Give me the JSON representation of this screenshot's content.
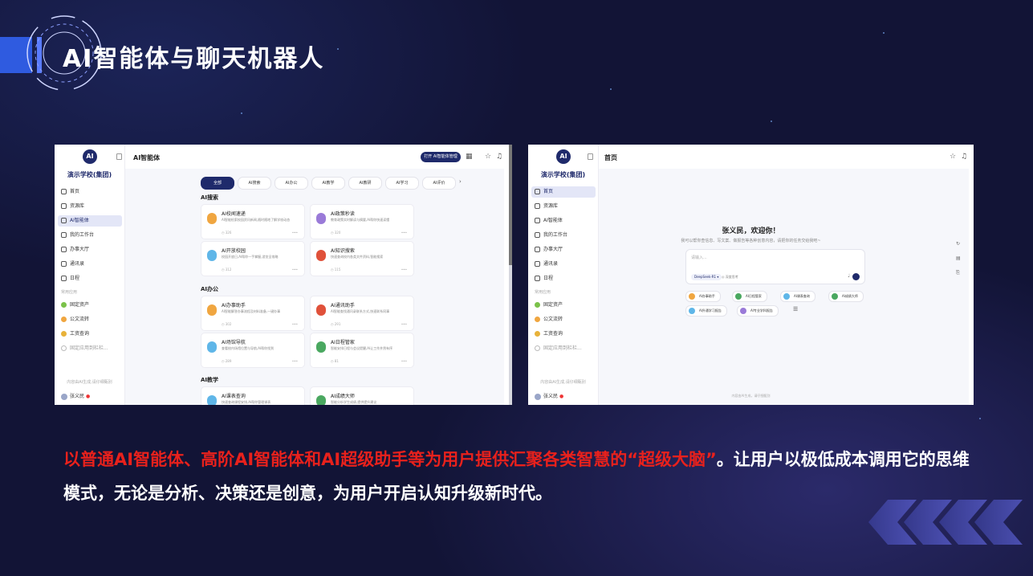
{
  "slide": {
    "title": "AI智能体与聊天机器人",
    "body_highlight": "以普通AI智能体、高阶AI智能体和AI超级助手等为用户提供汇聚各类智慧的“超级大脑”",
    "body_rest": "。让用户以极低成本调用它的思维模式，无论是分析、决策还是创意，为用户开启认知升级新时代。"
  },
  "left_window": {
    "school_name": "演示学校(集团)",
    "header_title": "AI智能体",
    "open_button": "打开 AI智能体管理",
    "nav": [
      "首页",
      "资源库",
      "AI智能体",
      "我的工作台",
      "办事大厅",
      "通讯录",
      "日程"
    ],
    "nav_section": "常用应用",
    "apps": [
      "固定资产",
      "公文流转",
      "工资查询",
      "固定应用到栏栏..."
    ],
    "side_footer": "内容由AI生成,请仔细甄别",
    "user": "张义民",
    "chips": [
      "全部",
      "AI搜索",
      "AI办公",
      "AI教学",
      "AI教研",
      "AI学习",
      "AI评价"
    ],
    "sections": [
      "AI搜索",
      "AI办公",
      "AI教学"
    ],
    "cards": [
      {
        "title": "AI校闻速递",
        "desc": "AI智能检索校园资讯新闻,随时随地了解学校动态",
        "meta": "◷ 326",
        "color": "#f0a640"
      },
      {
        "title": "AI政策秒读",
        "desc": "教育政策实时解读与摘要,AI帮你快速读懂",
        "meta": "◷ 320",
        "color": "#9a7ad8"
      },
      {
        "title": "AI开放校园",
        "desc": "校园开放日,AI帮你一手掌握,游览全攻略",
        "meta": "◷ 312",
        "color": "#5fb6e8"
      },
      {
        "title": "AI知识搜索",
        "desc": "快速查询校内各类文件资料,智能搜索",
        "meta": "◷ 115",
        "color": "#e0513a"
      },
      {
        "title": "AI办事助手",
        "desc": "AI智能解答办事流程及材料准备,一键办事",
        "meta": "◷ 302",
        "color": "#f0a640"
      },
      {
        "title": "AI通讯助手",
        "desc": "AI智能查找通讯录联系方式,快速联系同事",
        "meta": "◷ 291",
        "color": "#e0513a"
      },
      {
        "title": "AI场馆导航",
        "desc": "查看校内场馆位置与导航,AI帮你找到",
        "meta": "◷ 289",
        "color": "#5fb6e8"
      },
      {
        "title": "AI日程管家",
        "desc": "智能安排日程与会议提醒,AI让工作井然有序",
        "meta": "◷ 81",
        "color": "#4aa860"
      },
      {
        "title": "AI课表查询",
        "desc": "快速查询课程安排,AI帮你管理课表",
        "meta": "",
        "color": "#5fb6e8"
      },
      {
        "title": "AI成绩大师",
        "desc": "智能分析学生成绩,提供提升建议",
        "meta": "",
        "color": "#4aa860"
      }
    ]
  },
  "right_window": {
    "school_name": "演示学校(集团)",
    "header_title": "首页",
    "nav": [
      "首页",
      "资源库",
      "AI智能体",
      "我的工作台",
      "办事大厅",
      "通讯录",
      "日程"
    ],
    "nav_section": "常用应用",
    "apps": [
      "固定资产",
      "公文流转",
      "工资查询",
      "固定应用到栏栏..."
    ],
    "side_footer": "内容由AI生成,请仔细甄别",
    "user": "张义民",
    "greeting": "张义民，欢迎你！",
    "greeting_sub": "我可以帮你查信息、写文案、做报告等各种创意内容，请把你的任务交给我吧~",
    "input_placeholder": "请输入...",
    "model": "DeepSeek-R1 ▾",
    "deep_think": "◎ 深度思考",
    "quick_pills": [
      "AI办事助手",
      "AI日程管家",
      "AI课表查询",
      "AI成绩大师",
      "AI升通学习报告",
      "AI专业学科报告"
    ],
    "disclaimer": "内容由AI生成，请仔细甄别"
  }
}
